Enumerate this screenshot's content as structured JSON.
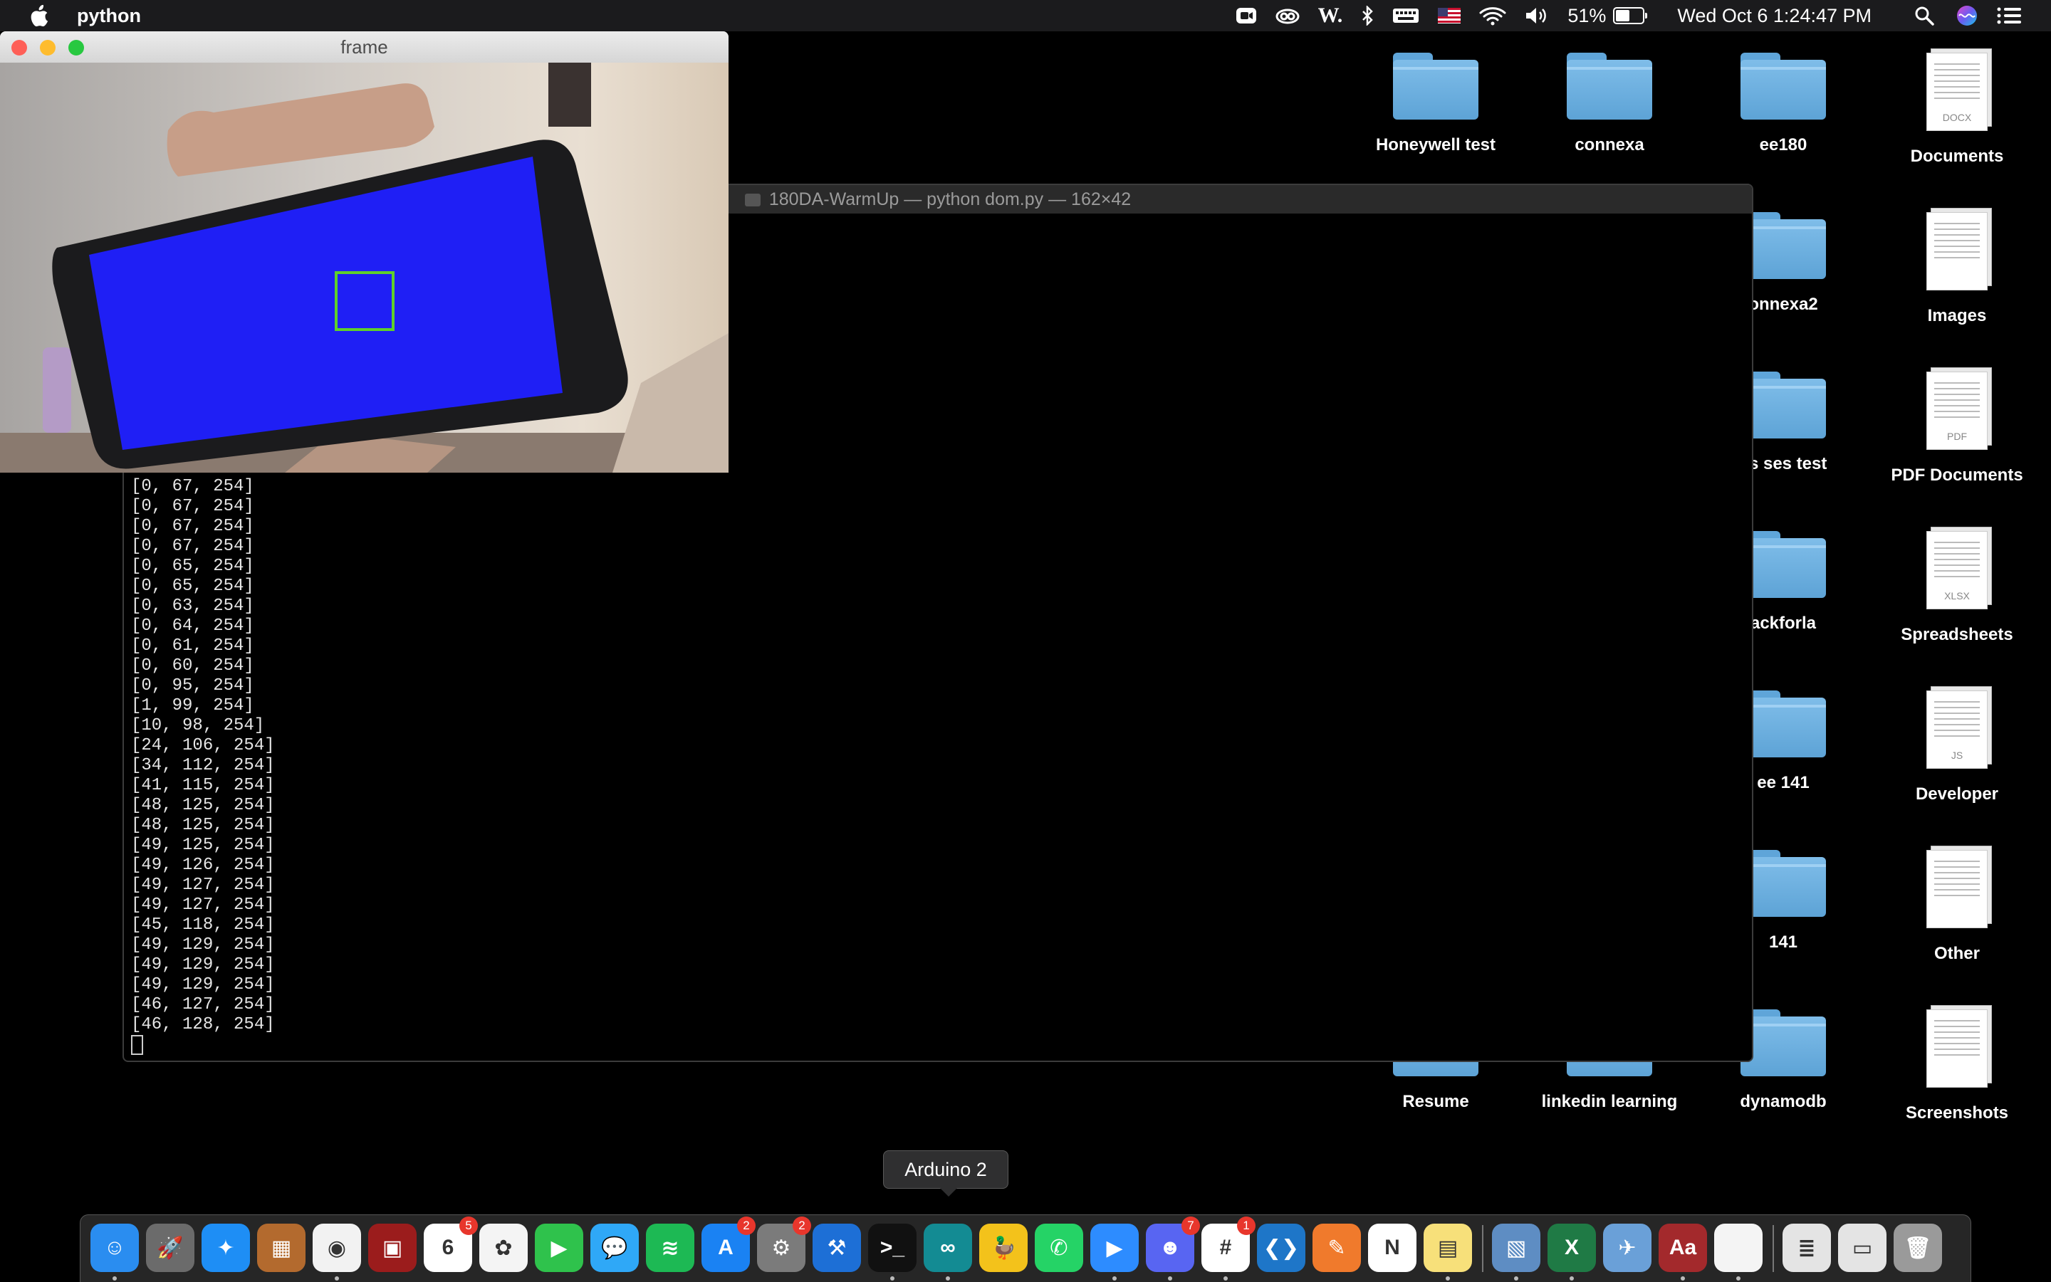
{
  "menubar": {
    "app_name": "python",
    "battery_percent": "51%",
    "battery_level": 0.51,
    "clock": "Wed Oct 6  1:24:47 PM",
    "icons": [
      "zoom-icon",
      "creative-cloud-icon",
      "word-w-icon",
      "bluetooth-icon",
      "keyboard-icon",
      "us-flag-icon",
      "wifi-icon",
      "volume-icon",
      "battery-icon",
      "spotlight-icon",
      "siri-icon",
      "control-center-icon"
    ]
  },
  "desktop": {
    "icons": [
      {
        "label": "Honeywell test",
        "type": "folder"
      },
      {
        "label": "connexa",
        "type": "folder"
      },
      {
        "label": "ee180",
        "type": "folder"
      },
      {
        "label": "Documents",
        "type": "stack",
        "ext": "DOCX"
      },
      {
        "label": "onnexa2",
        "type": "folder"
      },
      {
        "label": "Images",
        "type": "stack",
        "ext": ""
      },
      {
        "label": "vs ses test",
        "type": "folder"
      },
      {
        "label": "PDF Documents",
        "type": "stack",
        "ext": "PDF"
      },
      {
        "label": "ackforla",
        "type": "folder"
      },
      {
        "label": "Spreadsheets",
        "type": "stack",
        "ext": "XLSX"
      },
      {
        "label": "ee 141",
        "type": "folder"
      },
      {
        "label": "Developer",
        "type": "stack",
        "ext": "JS"
      },
      {
        "label": "141",
        "type": "folder"
      },
      {
        "label": "Other",
        "type": "stack",
        "ext": ""
      },
      {
        "label": "Resume",
        "type": "folder"
      },
      {
        "label": "linkedin learning",
        "type": "folder"
      },
      {
        "label": "dynamodb",
        "type": "folder"
      },
      {
        "label": "Screenshots",
        "type": "stack",
        "ext": ""
      }
    ]
  },
  "terminal": {
    "title": "180DA-WarmUp — python dom.py — 162×42",
    "lines": [
      "[0, 67, 254]",
      "[0, 67, 254]",
      "[0, 67, 254]",
      "[0, 67, 254]",
      "[0, 65, 254]",
      "[0, 65, 254]",
      "[0, 63, 254]",
      "[0, 64, 254]",
      "[0, 61, 254]",
      "[0, 60, 254]",
      "[0, 95, 254]",
      "[1, 99, 254]",
      "[10, 98, 254]",
      "[24, 106, 254]",
      "[34, 112, 254]",
      "[41, 115, 254]",
      "[48, 125, 254]",
      "[48, 125, 254]",
      "[49, 125, 254]",
      "[49, 126, 254]",
      "[49, 127, 254]",
      "[49, 127, 254]",
      "[45, 118, 254]",
      "[49, 129, 254]",
      "[49, 129, 254]",
      "[49, 129, 254]",
      "[46, 127, 254]",
      "[46, 128, 254]"
    ]
  },
  "frame_window": {
    "title": "frame",
    "colors": {
      "close": "#fe5f57",
      "minimize": "#febc2e",
      "zoom": "#28c840",
      "phone_screen": "#1f1ff5",
      "roi_box": "#5fd02a"
    }
  },
  "tooltip": {
    "text": "Arduino 2"
  },
  "dock": {
    "apps": [
      {
        "name": "finder-icon",
        "bg": "#2a8df0",
        "glyph": "☺",
        "running": true
      },
      {
        "name": "launchpad-icon",
        "bg": "#6b6b6b",
        "glyph": "🚀",
        "running": false
      },
      {
        "name": "safari-icon",
        "bg": "#1e8ef5",
        "glyph": "✦",
        "running": false
      },
      {
        "name": "calculator-icon",
        "bg": "#b36a2e",
        "glyph": "▦",
        "running": false
      },
      {
        "name": "chrome-icon",
        "bg": "#f2f2f2",
        "glyph": "◉",
        "running": true
      },
      {
        "name": "photo-booth-icon",
        "bg": "#9b1c1c",
        "glyph": "▣",
        "running": false
      },
      {
        "name": "calendar-icon",
        "bg": "#ffffff",
        "glyph": "6",
        "badge": "5",
        "running": false
      },
      {
        "name": "photos-icon",
        "bg": "#f4f4f4",
        "glyph": "✿",
        "running": false
      },
      {
        "name": "facetime-icon",
        "bg": "#2fc24c",
        "glyph": "▶",
        "running": false
      },
      {
        "name": "messages-icon",
        "bg": "#2fa8f7",
        "glyph": "💬",
        "running": false
      },
      {
        "name": "spotify-icon",
        "bg": "#1db954",
        "glyph": "≋",
        "running": false
      },
      {
        "name": "app-store-icon",
        "bg": "#1a82f3",
        "glyph": "A",
        "badge": "2",
        "running": false
      },
      {
        "name": "system-preferences-icon",
        "bg": "#7b7b7b",
        "glyph": "⚙",
        "badge": "2",
        "running": false
      },
      {
        "name": "xcode-icon",
        "bg": "#1d6fd6",
        "glyph": "⚒",
        "running": false
      },
      {
        "name": "terminal-icon",
        "bg": "#111111",
        "glyph": ">_",
        "running": true
      },
      {
        "name": "arduino-icon",
        "bg": "#138b93",
        "glyph": "∞",
        "running": true
      },
      {
        "name": "cyberduck-icon",
        "bg": "#f3c21b",
        "glyph": "🦆",
        "running": false
      },
      {
        "name": "whatsapp-icon",
        "bg": "#25d366",
        "glyph": "✆",
        "running": false
      },
      {
        "name": "zoom-icon",
        "bg": "#2d8cff",
        "glyph": "▶",
        "running": true
      },
      {
        "name": "discord-icon",
        "bg": "#5865f2",
        "glyph": "☻",
        "badge": "7",
        "running": true
      },
      {
        "name": "slack-icon",
        "bg": "#ffffff",
        "glyph": "#",
        "badge": "1",
        "running": true
      },
      {
        "name": "vscode-icon",
        "bg": "#1e76c8",
        "glyph": "❮❯",
        "running": false
      },
      {
        "name": "paw-icon",
        "bg": "#f07a2c",
        "glyph": "✎",
        "running": false
      },
      {
        "name": "notion-icon",
        "bg": "#ffffff",
        "glyph": "N",
        "running": false
      },
      {
        "name": "stickies-icon",
        "bg": "#f7e07a",
        "glyph": "▤",
        "running": true
      },
      {
        "name": "preview-icon",
        "bg": "#5e8dc3",
        "glyph": "▧",
        "running": true
      },
      {
        "name": "excel-icon",
        "bg": "#1f7a45",
        "glyph": "X",
        "running": true
      },
      {
        "name": "mail-stamp-icon",
        "bg": "#6aa0d8",
        "glyph": "✈",
        "running": false
      },
      {
        "name": "dictionary-icon",
        "bg": "#a3292c",
        "glyph": "Aa",
        "running": true
      },
      {
        "name": "document-icon",
        "bg": "#f4f4f4",
        "glyph": "",
        "running": true
      },
      {
        "name": "downloads-stack-icon",
        "bg": "#e4e4e4",
        "glyph": "≣",
        "running": false
      },
      {
        "name": "screenshot-stack-icon",
        "bg": "#e4e4e4",
        "glyph": "▭",
        "running": false
      },
      {
        "name": "trash-icon",
        "bg": "#9a9a9a",
        "glyph": "🗑",
        "running": false
      }
    ]
  }
}
